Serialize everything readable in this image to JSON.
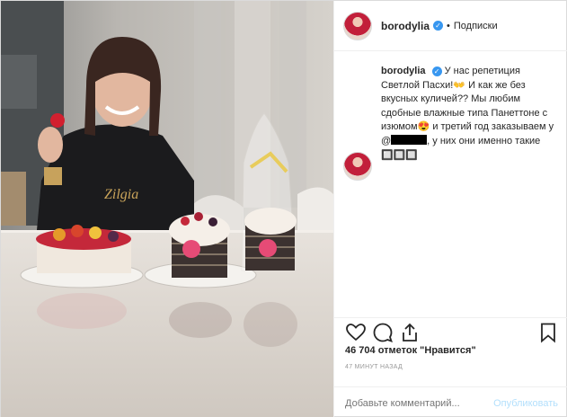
{
  "header": {
    "username": "borodylia",
    "verified_mark": "✓",
    "separator": "•",
    "follow_label": "Подписки"
  },
  "caption": {
    "username": "borodylia",
    "text_part1": "У нас репетиция Светлой Пасхи!",
    "emoji1": "👐",
    "text_part2": " И как же без вкусных куличей?? Мы любим сдобные влажные типа Панеттоне с изюмом",
    "emoji2": "😍",
    "text_part3": " и третий год заказываем у @",
    "text_part4": ", у них они именно такие ",
    "emoji3": "🔲🔲🔲"
  },
  "actions": {
    "icons": [
      "heart-icon",
      "comment-icon",
      "share-icon",
      "bookmark-icon"
    ],
    "likes_text": "46 704 отметок \"Нравится\"",
    "time_text": "47 МИНУТ НАЗАД"
  },
  "comment": {
    "placeholder": "Добавьте комментарий...",
    "publish_label": "Опубликовать"
  },
  "colors": {
    "verified": "#3897f0",
    "publish_disabled": "#b2dffc",
    "border": "#dbdbdb"
  }
}
